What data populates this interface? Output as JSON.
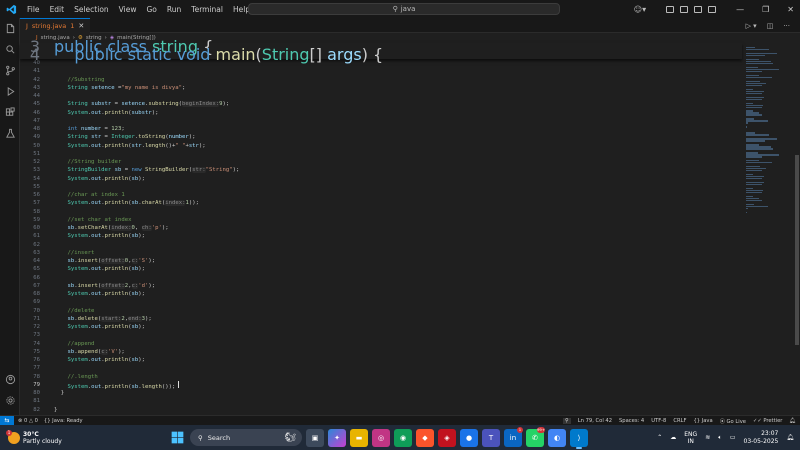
{
  "titlebar": {
    "menu": [
      "File",
      "Edit",
      "Selection",
      "View",
      "Go",
      "Run",
      "Terminal",
      "Help"
    ],
    "search_text": "java"
  },
  "tab": {
    "label": "string.java",
    "badge": "1"
  },
  "breadcrumb": {
    "file": "string.java",
    "class": "string",
    "method": "main(String[])"
  },
  "sticky_lines": [
    {
      "ln": "3",
      "html": "<span class='kw'>public class</span> <span class='ty'>string</span> {"
    },
    {
      "ln": "4",
      "html": "    <span class='kw'>public static void</span> <span class='fn'>main</span>(<span class='ty'>String</span>[] <span class='va'>args</span>) {"
    }
  ],
  "code_lines": [
    {
      "ln": "40",
      "html": ""
    },
    {
      "ln": "41",
      "html": ""
    },
    {
      "ln": "42",
      "html": "    <span class='cm'>//Substring</span>"
    },
    {
      "ln": "43",
      "html": "    <span class='ty'>String</span> <span class='va'>setence</span> =<span class='st'>\"my name is divya\"</span>;"
    },
    {
      "ln": "44",
      "html": ""
    },
    {
      "ln": "45",
      "html": "    <span class='ty'>String</span> <span class='va'>substr</span> = <span class='va'>setence</span>.<span class='fn'>substring</span>(<span class='hint'>beginIndex:</span><span class='nu'>9</span>);"
    },
    {
      "ln": "46",
      "html": "    <span class='ty'>System</span>.<span class='va'>out</span>.<span class='fn'>println</span>(<span class='va'>substr</span>);"
    },
    {
      "ln": "47",
      "html": ""
    },
    {
      "ln": "48",
      "html": "    <span class='kw'>int</span> <span class='va'>number</span> = <span class='nu'>123</span>;"
    },
    {
      "ln": "49",
      "html": "    <span class='ty'>String</span> <span class='va'>str</span> = <span class='ty'>Integer</span>.<span class='fn'>toString</span>(<span class='va'>number</span>);"
    },
    {
      "ln": "50",
      "html": "    <span class='ty'>System</span>.<span class='va'>out</span>.<span class='fn'>println</span>(<span class='va'>str</span>.<span class='fn'>length</span>()+<span class='st'>\" \"</span>+<span class='va'>str</span>);"
    },
    {
      "ln": "51",
      "html": ""
    },
    {
      "ln": "52",
      "html": "    <span class='cm'>//String builder</span>"
    },
    {
      "ln": "53",
      "html": "    <span class='ty'>StringBuilder</span> <span class='va'>sb</span> = <span class='kw'>new</span> <span class='fn'>StringBuilder</span>(<span class='hint'>str:</span><span class='st'>\"String\"</span>);"
    },
    {
      "ln": "54",
      "html": "    <span class='ty'>System</span>.<span class='va'>out</span>.<span class='fn'>println</span>(<span class='va'>sb</span>);"
    },
    {
      "ln": "55",
      "html": ""
    },
    {
      "ln": "56",
      "html": "    <span class='cm'>//char at index 1</span>"
    },
    {
      "ln": "57",
      "html": "    <span class='ty'>System</span>.<span class='va'>out</span>.<span class='fn'>println</span>(<span class='va'>sb</span>.<span class='fn'>charAt</span>(<span class='hint'>index:</span><span class='nu'>1</span>));"
    },
    {
      "ln": "58",
      "html": ""
    },
    {
      "ln": "59",
      "html": "    <span class='cm'>//set char at index</span>"
    },
    {
      "ln": "60",
      "html": "    <span class='va'>sb</span>.<span class='fn'>setCharAt</span>(<span class='hint'>index:</span><span class='nu'>0</span>, <span class='hint'>ch:</span><span class='st'>'p'</span>);"
    },
    {
      "ln": "61",
      "html": "    <span class='ty'>System</span>.<span class='va'>out</span>.<span class='fn'>println</span>(<span class='va'>sb</span>);"
    },
    {
      "ln": "62",
      "html": ""
    },
    {
      "ln": "63",
      "html": "    <span class='cm'>//insert</span>"
    },
    {
      "ln": "64",
      "html": "    <span class='va'>sb</span>.<span class='fn'>insert</span>(<span class='hint'>offset:</span><span class='nu'>0</span>,<span class='hint'>c:</span><span class='st'>'S'</span>);"
    },
    {
      "ln": "65",
      "html": "    <span class='ty'>System</span>.<span class='va'>out</span>.<span class='fn'>println</span>(<span class='va'>sb</span>);"
    },
    {
      "ln": "66",
      "html": ""
    },
    {
      "ln": "67",
      "html": "    <span class='va'>sb</span>.<span class='fn'>insert</span>(<span class='hint'>offset:</span><span class='nu'>2</span>,<span class='hint'>c:</span><span class='st'>'d'</span>);"
    },
    {
      "ln": "68",
      "html": "    <span class='ty'>System</span>.<span class='va'>out</span>.<span class='fn'>println</span>(<span class='va'>sb</span>);"
    },
    {
      "ln": "69",
      "html": ""
    },
    {
      "ln": "70",
      "html": "    <span class='cm'>//delete</span>"
    },
    {
      "ln": "71",
      "html": "    <span class='va'>sb</span>.<span class='fn'>delete</span>(<span class='hint'>start:</span><span class='nu'>2</span>,<span class='hint'>end:</span><span class='nu'>3</span>);"
    },
    {
      "ln": "72",
      "html": "    <span class='ty'>System</span>.<span class='va'>out</span>.<span class='fn'>println</span>(<span class='va'>sb</span>);"
    },
    {
      "ln": "73",
      "html": ""
    },
    {
      "ln": "74",
      "html": "    <span class='cm'>//append</span>"
    },
    {
      "ln": "75",
      "html": "    <span class='va'>sb</span>.<span class='fn'>append</span>(<span class='hint'>c:</span><span class='st'>'V'</span>);"
    },
    {
      "ln": "76",
      "html": "    <span class='ty'>System</span>.<span class='va'>out</span>.<span class='fn'>println</span>(<span class='va'>sb</span>);"
    },
    {
      "ln": "77",
      "html": ""
    },
    {
      "ln": "78",
      "html": "    <span class='cm'>//.length</span>"
    },
    {
      "ln": "79",
      "html": "    <span class='ty'>System</span>.<span class='va'>out</span>.<span class='fn'>println</span>(<span class='va'>sb</span>.<span class='fn'>length</span>());<span class='cursor'></span>",
      "active": true
    },
    {
      "ln": "80",
      "html": "  }"
    },
    {
      "ln": "81",
      "html": ""
    },
    {
      "ln": "82",
      "html": "}"
    }
  ],
  "statusbar": {
    "errors": "0",
    "warnings": "0",
    "java_status": "Java: Ready",
    "position": "Ln 79, Col 42",
    "spaces": "Spaces: 4",
    "encoding": "UTF-8",
    "eol": "CRLF",
    "language": "Java",
    "golive": "Go Live",
    "prettier": "Prettier"
  },
  "taskbar": {
    "weather_temp": "30°C",
    "weather_desc": "Partly cloudy",
    "weather_badge": "1",
    "search_label": "Search",
    "lang_top": "ENG",
    "lang_bottom": "IN",
    "time": "23:07",
    "date": "03-05-2025",
    "badges": {
      "teams": "1",
      "whatsapp": "99+"
    }
  }
}
